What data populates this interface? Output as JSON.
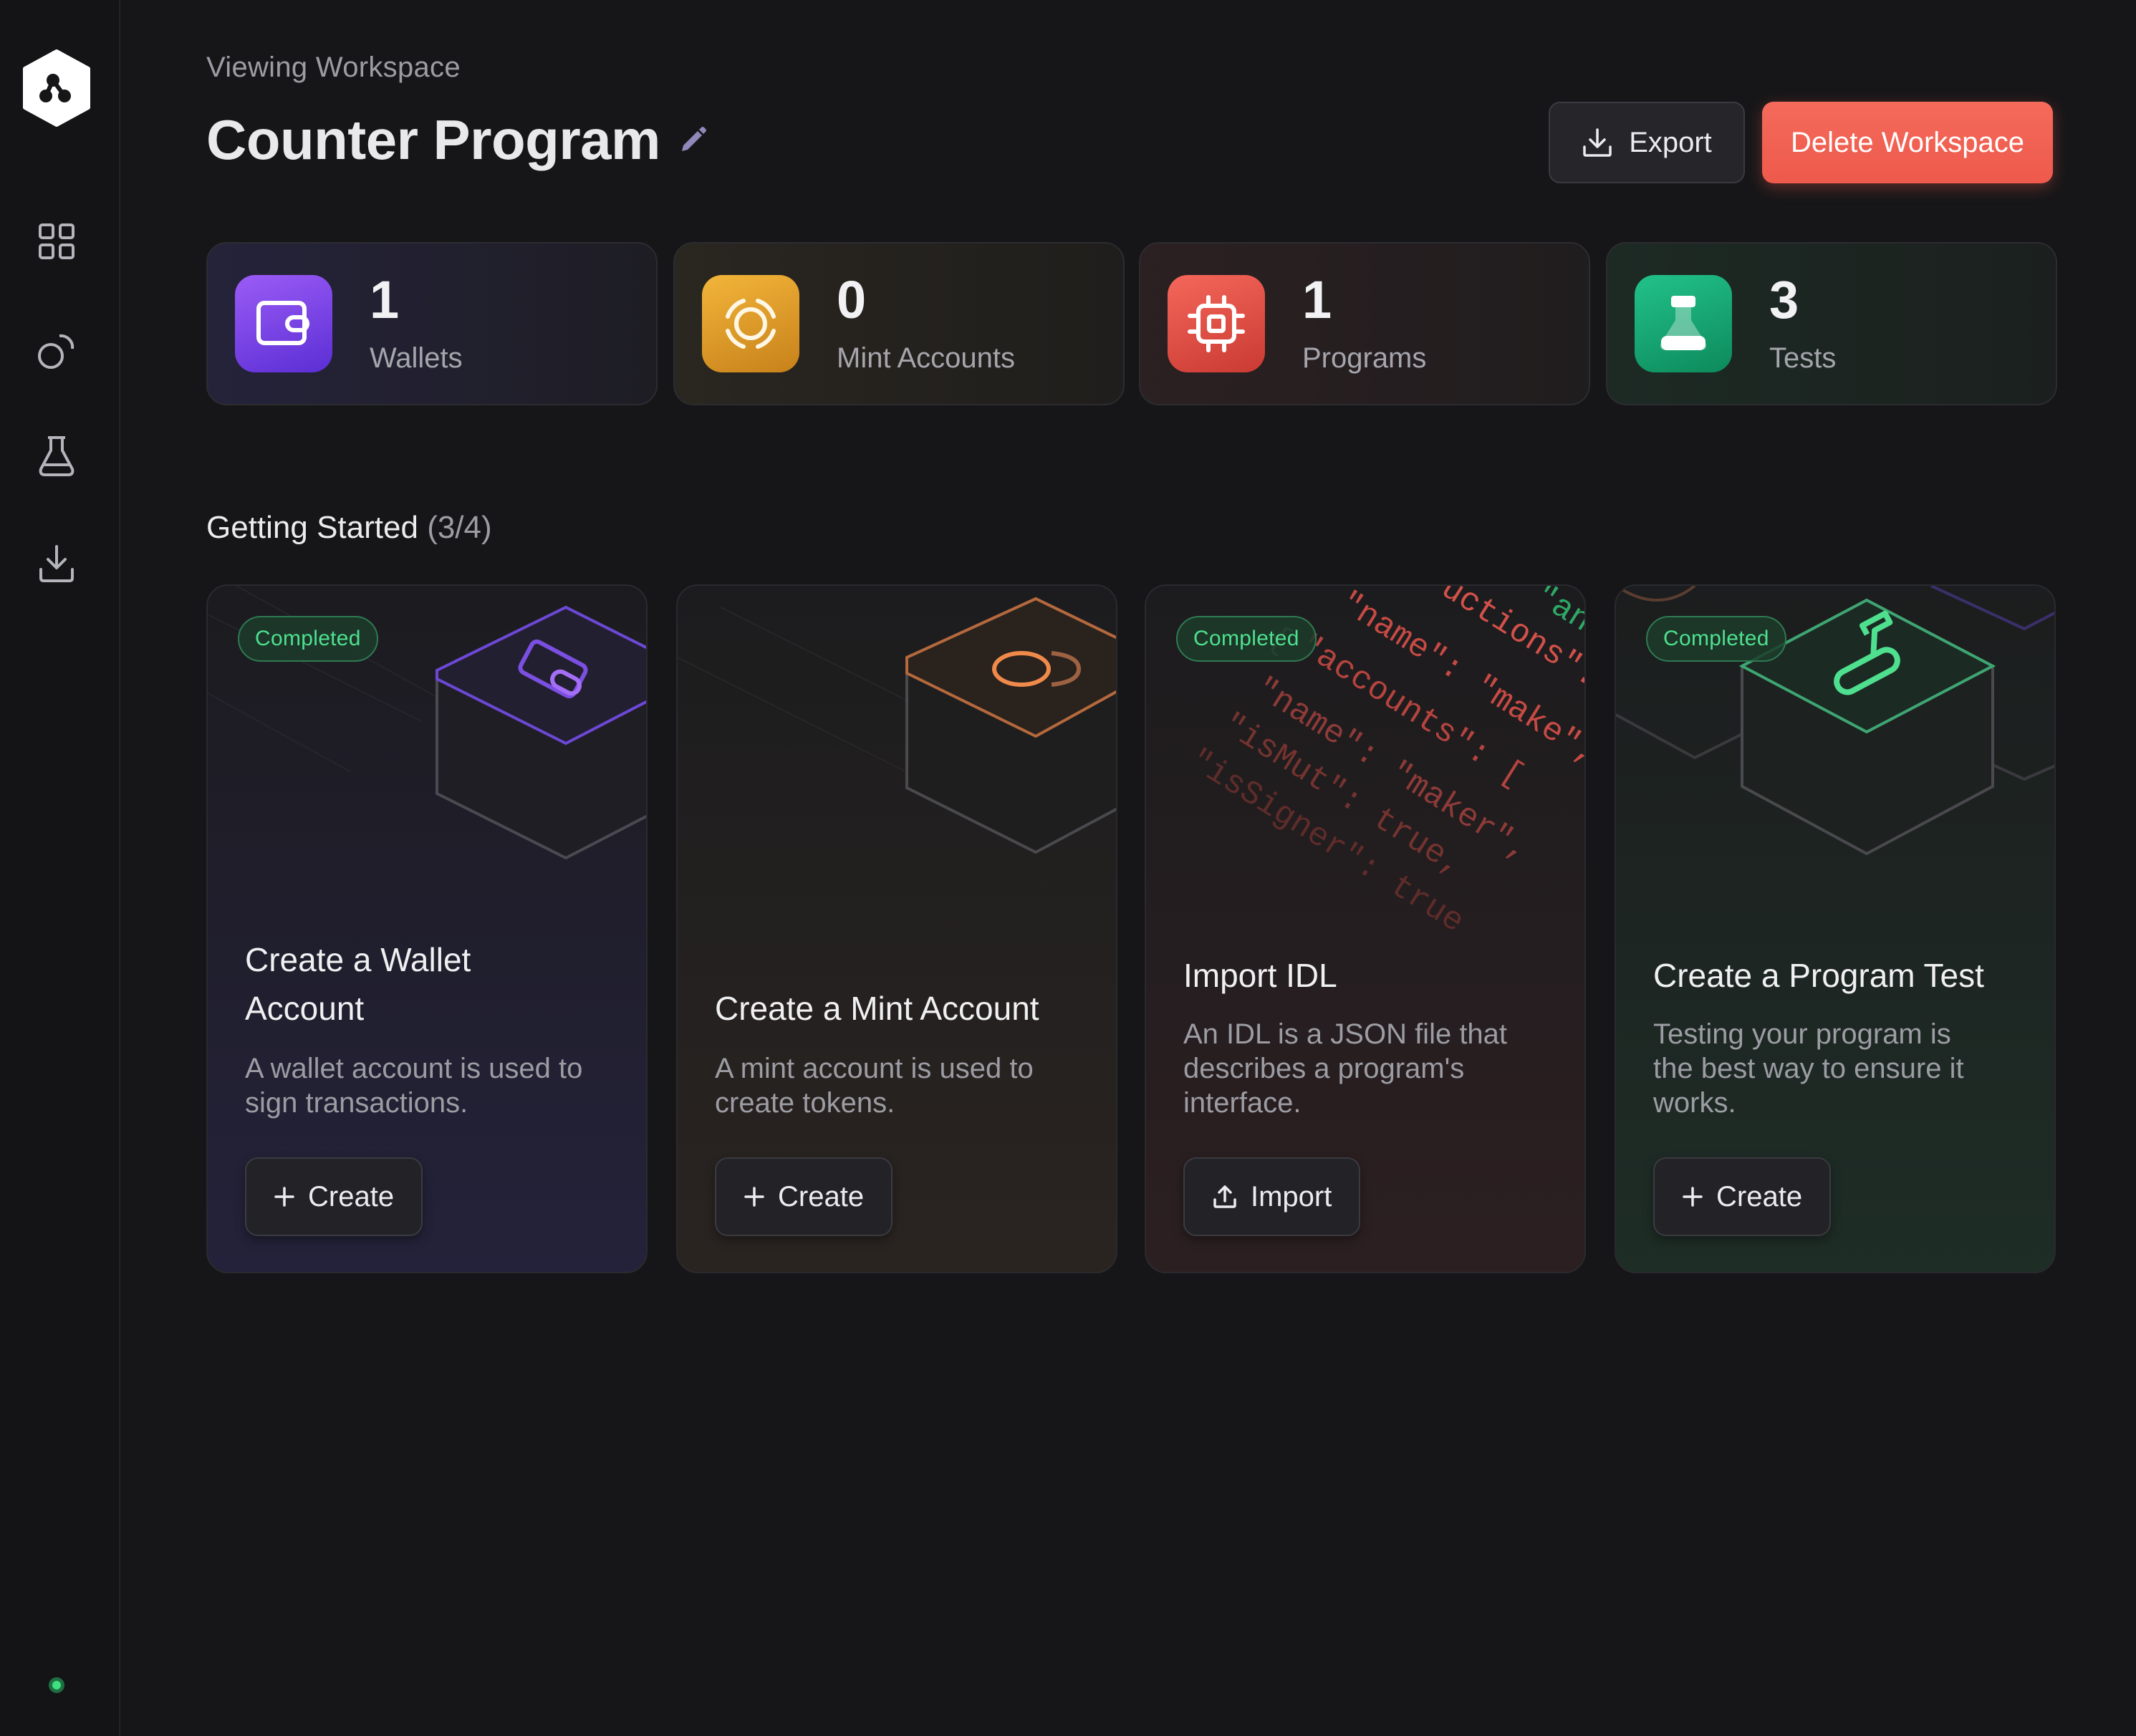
{
  "header": {
    "eyebrow": "Viewing Workspace",
    "title": "Counter Program",
    "export_label": "Export",
    "delete_label": "Delete Workspace"
  },
  "stats": [
    {
      "value": "1",
      "label": "Wallets",
      "icon": "wallet-icon",
      "color": "#7c3aed"
    },
    {
      "value": "0",
      "label": "Mint Accounts",
      "icon": "mint-coin-icon",
      "color": "#e0a12a"
    },
    {
      "value": "1",
      "label": "Programs",
      "icon": "chip-icon",
      "color": "#e6483f"
    },
    {
      "value": "3",
      "label": "Tests",
      "icon": "flask-icon",
      "color": "#17a873"
    }
  ],
  "getting_started": {
    "title": "Getting Started",
    "count": "(3/4)"
  },
  "cards": [
    {
      "badge": "Completed",
      "title_line1": "Create a Wallet",
      "title_line2": "Account",
      "desc_line1": "A wallet account is used to",
      "desc_line2": "sign transactions.",
      "button": "Create",
      "accent": "#7b4fe0"
    },
    {
      "title": "Create a Mint Account",
      "desc_line1": "A mint account is used to",
      "desc_line2": "create tokens.",
      "button": "Create",
      "accent": "#f08a4b"
    },
    {
      "badge": "Completed",
      "title": "Import IDL",
      "desc_line1": "An IDL is a JSON file that",
      "desc_line2": "describes a program's",
      "desc_line3": "interface.",
      "button": "Import",
      "accent": "#e6483f",
      "code_lines": [
        "\"name\": \"make\",",
        "\"accounts\": [",
        "\"name\": \"maker\",",
        "\"isMut\": true,",
        "\"isSigner\": true",
        "uctions\": [",
        "\"anc",
        "{"
      ]
    },
    {
      "badge": "Completed",
      "title": "Create a Program Test",
      "desc_line1": "Testing your program is",
      "desc_line2": "the best way to ensure it",
      "desc_line3": "works.",
      "button": "Create",
      "accent": "#3ecf8e"
    }
  ]
}
